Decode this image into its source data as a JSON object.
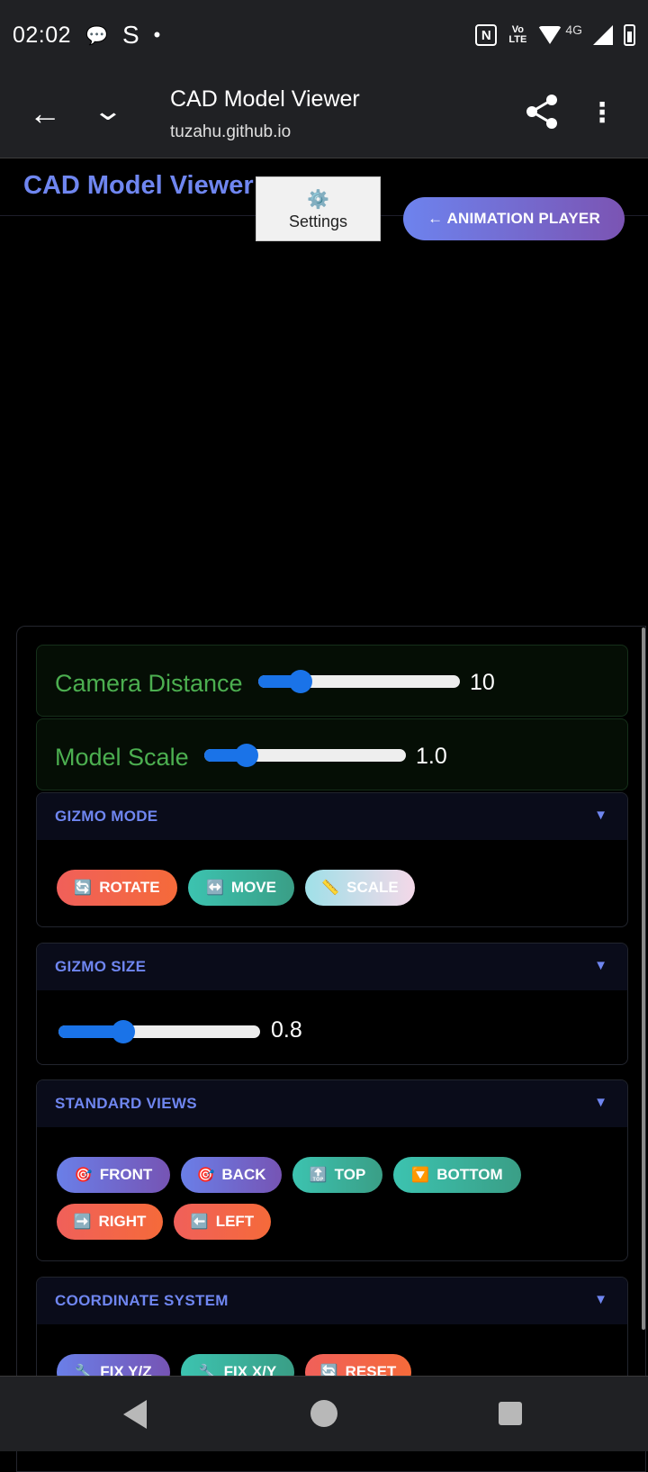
{
  "status_bar": {
    "time": "02:02",
    "left_icons": [
      "chat-bubble-icon",
      "s-app-icon",
      "dot-icon"
    ],
    "s_glyph": "S",
    "dot_glyph": "•",
    "nfc_glyph": "N",
    "lte_label": "Vo LTE",
    "network_label": "4G",
    "right_icons": [
      "nfc-icon",
      "volte-icon",
      "wifi-icon",
      "signal-icon",
      "battery-charging-icon"
    ]
  },
  "browser": {
    "title": "CAD Model Viewer",
    "url": "tuzahu.github.io",
    "back_glyph": "←",
    "chevron_glyph": "⌄",
    "more_glyph": "⋮"
  },
  "page": {
    "title": "CAD Model Viewer",
    "settings_label": "Settings",
    "settings_icon": "⚙️",
    "animation_button": "← ANIMATION PLAYER"
  },
  "controls": {
    "camera_distance": {
      "label": "Camera Distance",
      "value_text": "10",
      "fraction": 0.21
    },
    "model_scale": {
      "label": "Model Scale",
      "value_text": "1.0",
      "fraction": 0.21
    },
    "gizmo_mode": {
      "title": "GIZMO MODE",
      "arrow": "▼",
      "buttons": [
        {
          "icon": "🔄",
          "label": "ROTATE",
          "color": "red"
        },
        {
          "icon": "↔️",
          "label": "MOVE",
          "color": "teal"
        },
        {
          "icon": "📏",
          "label": "SCALE",
          "color": "light"
        }
      ]
    },
    "gizmo_size": {
      "title": "GIZMO SIZE",
      "arrow": "▼",
      "value_text": "0.8",
      "fraction": 0.32
    },
    "standard_views": {
      "title": "STANDARD VIEWS",
      "arrow": "▼",
      "buttons": [
        {
          "icon": "🎯",
          "label": "FRONT"
        },
        {
          "icon": "🎯",
          "label": "BACK"
        },
        {
          "icon": "🔝",
          "label": "TOP"
        },
        {
          "icon": "🔽",
          "label": "BOTTOM"
        },
        {
          "icon": "➡️",
          "label": "RIGHT"
        },
        {
          "icon": "⬅️",
          "label": "LEFT"
        }
      ]
    },
    "coordinate_system": {
      "title": "COORDINATE SYSTEM",
      "arrow": "▼",
      "buttons": [
        {
          "icon": "🔧",
          "label": "FIX Y/Z"
        },
        {
          "icon": "🔧",
          "label": "FIX X/Y"
        },
        {
          "icon": "🔄",
          "label": "RESET"
        }
      ]
    }
  },
  "colors": {
    "accent": "#6f86f0",
    "slider_label": "#4caf50",
    "slider_fill": "#1a73e8"
  }
}
